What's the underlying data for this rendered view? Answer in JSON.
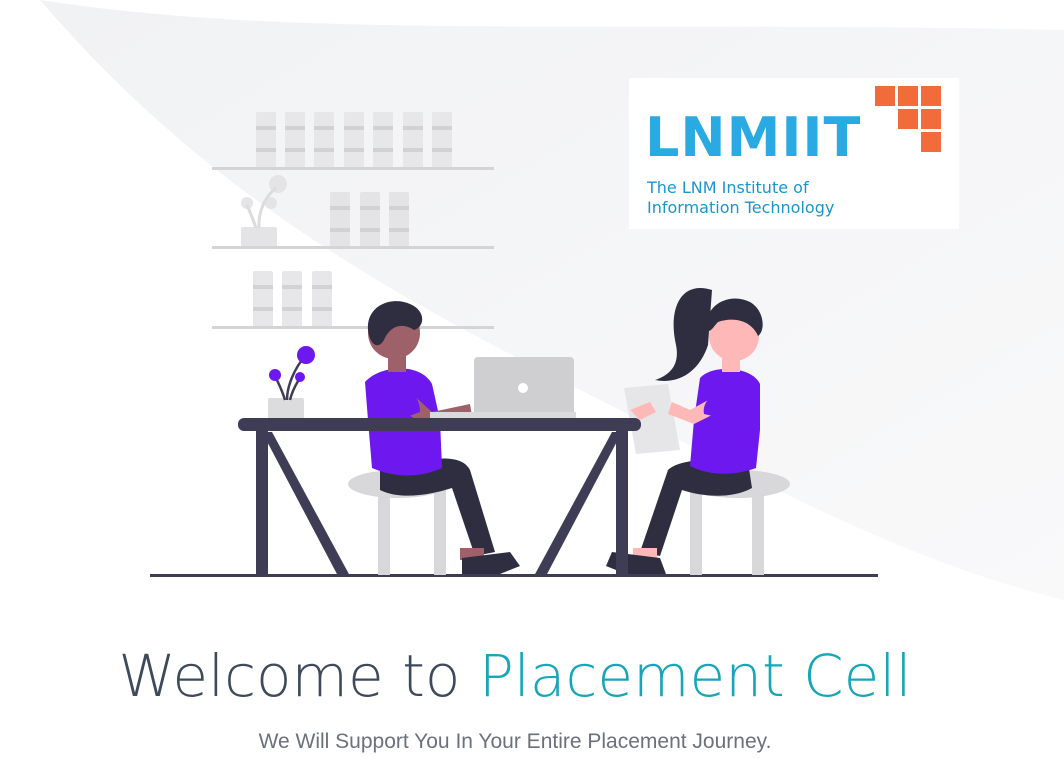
{
  "logo": {
    "title": "LNMIIT",
    "subtitle_line1": "The LNM Institute of",
    "subtitle_line2": "Information Technology",
    "text_color": "#2aaae2",
    "squares_color": "#f26b3a"
  },
  "hero": {
    "title_prefix": "Welcome to ",
    "title_accent": "Placement Cell",
    "tagline": "We Will Support You In Your Entire Placement Journey.",
    "accent_color": "#17a6b9"
  },
  "illustration": {
    "name": "two-people-working-at-desk-illustration",
    "shirt_color": "#6c18ef"
  }
}
